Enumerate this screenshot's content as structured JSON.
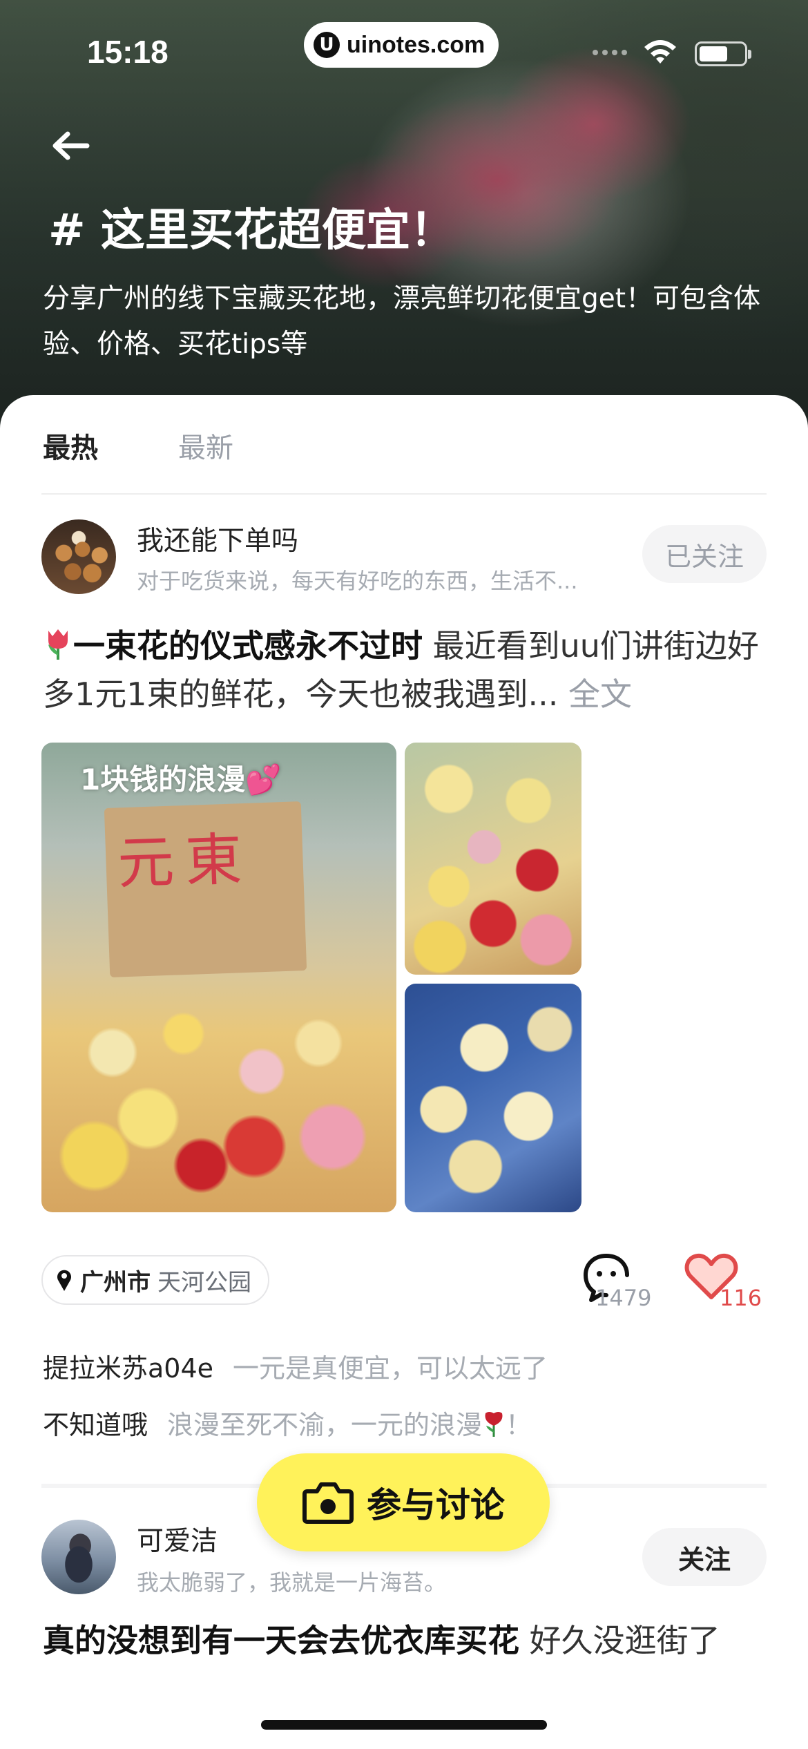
{
  "status_bar": {
    "time": "15:18",
    "watermark": "uinotes.com",
    "watermark_logo": "U"
  },
  "header": {
    "back_icon": "arrow-left-icon",
    "title": "# 这里买花超便宜！",
    "description": "分享广州的线下宝藏买花地，漂亮鲜切花便宜get！可包含体验、价格、买花tips等"
  },
  "tabs": [
    {
      "label": "最热",
      "active": true
    },
    {
      "label": "最新",
      "active": false
    }
  ],
  "posts": [
    {
      "author": "我还能下单吗",
      "subtitle": "对于吃货来说，每天有好吃的东西，生活不...",
      "follow_label": "已关注",
      "title": "一束花的仪式感永不过时",
      "excerpt": " 最近看到uu们讲街边好多1元1束的鲜花，今天也被我遇到... ",
      "full_text_label": "全文",
      "image_caption": "1块钱的浪漫💕",
      "sign_text": "元東",
      "location_city": "广州市",
      "location_place": "天河公园",
      "comment_count": "1479",
      "like_count": "116",
      "comments": [
        {
          "user": "提拉米苏a04e",
          "text": "一元是真便宜，可以太远了"
        },
        {
          "user": "不知道哦",
          "text": "浪漫至死不渝，一元的浪漫",
          "suffix": "！"
        }
      ]
    },
    {
      "author": "可爱洁",
      "subtitle": "我太脆弱了，我就是一片海苔。",
      "follow_label": "关注",
      "title": "真的没想到有一天会去优衣库买花",
      "excerpt": " 好久没逛街了"
    }
  ],
  "cta": {
    "label": "参与讨论",
    "icon": "camera-icon"
  },
  "colors": {
    "accent_yellow": "#fff25a",
    "like_red": "#e04a4a",
    "muted_gray": "#9a9fa8"
  }
}
